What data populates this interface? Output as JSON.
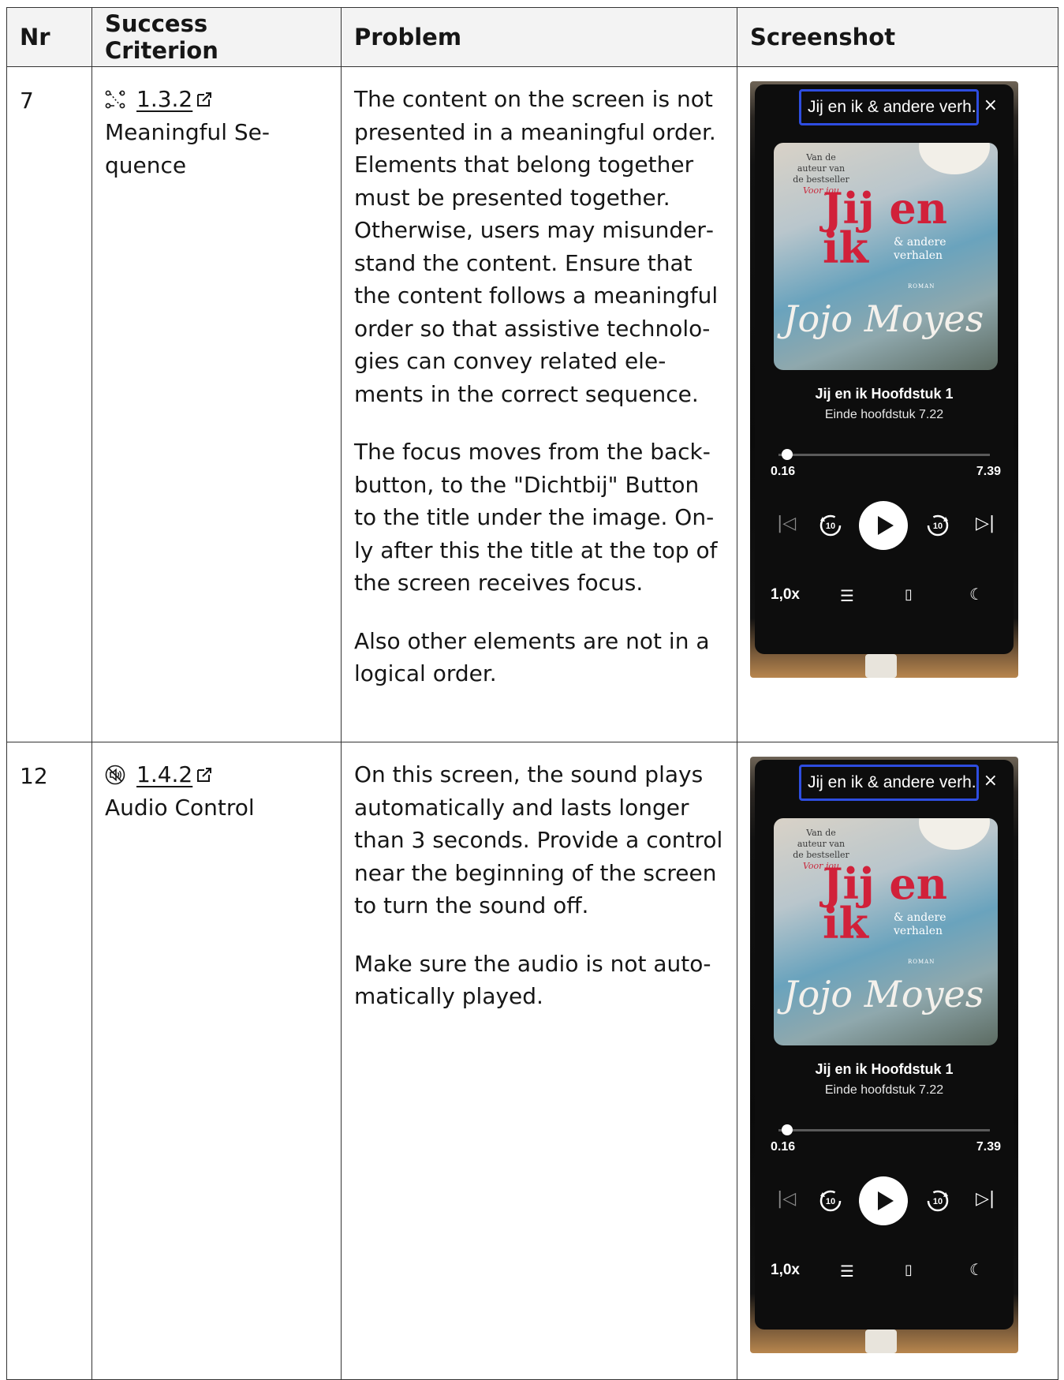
{
  "headers": [
    "Nr",
    "Success Criterion",
    "Problem",
    "Screenshot"
  ],
  "rows": [
    {
      "nr": "7",
      "criterion": {
        "icon": "sequence-icon",
        "code": "1.3.2",
        "name": "Meaningful Se- quence",
        "name_lines": [
          "Meaningful Se-",
          "quence"
        ]
      },
      "problem": [
        "The content on the screen is not presented in a meaningful order. Elements that belong together must be presented together. Otherwise, users may misunder­stand the content. Ensure that the content follows a meaningful order so that assistive technolo­gies can convey related ele­ments in the correct sequence.",
        "The focus moves from the back­button, to the \"Dichtbij\" Button to the title under the image. On­ly after this the title at the top of the screen receives focus.",
        "Also other elements are not in a logical order."
      ]
    },
    {
      "nr": "12",
      "criterion": {
        "icon": "audio-off-icon",
        "code": "1.4.2",
        "name": "Audio Control"
      },
      "problem": [
        "On this screen, the sound plays automatically and lasts longer than 3 seconds. Provide a con­trol near the beginning of the screen to turn the sound off.",
        "Make sure the audio is not auto­matically played."
      ]
    }
  ],
  "screenshot": {
    "tab_title": "Jij en ik & andere verh...",
    "close": "×",
    "cover_pre": [
      "Van de",
      "auteur van",
      "de bestseller",
      "Voor jou"
    ],
    "cover_title": [
      "Jij en",
      "ik"
    ],
    "cover_sub": [
      "& andere",
      "verhalen"
    ],
    "cover_roman": "ROMAN",
    "cover_author": "Jojo Moyes",
    "track": "Jij en ik Hoofdstuk 1",
    "track_sub": "Einde hoofdstuk 7.22",
    "time_left": "0.16",
    "time_right": "7.39",
    "progress": 0.04,
    "speed": "1,0x"
  }
}
